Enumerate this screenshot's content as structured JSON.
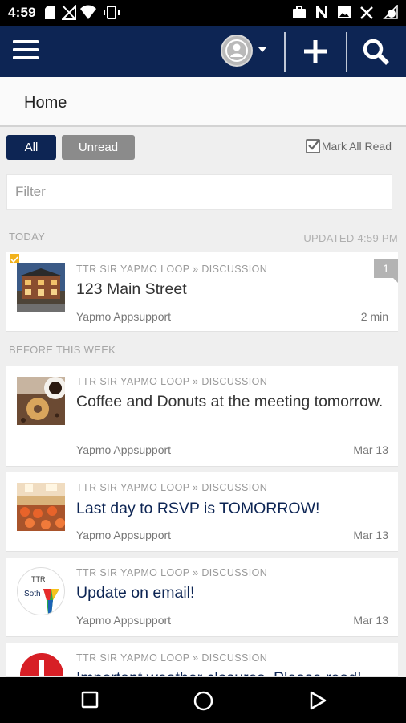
{
  "status_bar": {
    "time": "4:59",
    "icons": [
      "sd-card-icon",
      "no-signal-icon",
      "wifi-icon",
      "vibrate-icon",
      "briefcase-icon",
      "n-app-icon",
      "image-icon",
      "shuffle-icon",
      "battery-icon"
    ]
  },
  "app_bar": {
    "icons": [
      "menu-icon",
      "avatar-icon",
      "caret-down-icon",
      "plus-icon",
      "search-icon"
    ]
  },
  "header": {
    "title": "Home"
  },
  "tabs": [
    {
      "label": "All",
      "active": true
    },
    {
      "label": "Unread",
      "active": false
    }
  ],
  "mark_all": {
    "label": "Mark All Read"
  },
  "filter": {
    "placeholder": "Filter",
    "value": ""
  },
  "sections": {
    "today": "TODAY",
    "updated": "UPDATED 4:59 PM",
    "before": "BEFORE THIS WEEK"
  },
  "posts": [
    {
      "path": "TTR SIR YAPMO LOOP » DISCUSSION",
      "title": "123 Main Street",
      "author": "Yapmo Appsupport",
      "date": "2 min",
      "badge": "1",
      "thumb": "building-thumbnail"
    },
    {
      "path": "TTR SIR YAPMO LOOP » DISCUSSION",
      "title": "Coffee and Donuts at the meeting tomorrow.",
      "author": "Yapmo Appsupport",
      "date": "Mar 13",
      "thumb": "coffee-donut-thumbnail"
    },
    {
      "path": "TTR SIR YAPMO LOOP » DISCUSSION",
      "title": "Last day to RSVP is TOMORROW!",
      "author": "Yapmo Appsupport",
      "date": "Mar 13",
      "thumb": "event-room-thumbnail"
    },
    {
      "path": "TTR SIR YAPMO LOOP » DISCUSSION",
      "title": "Update on email!",
      "author": "Yapmo Appsupport",
      "date": "Mar 13",
      "thumb": "ttr-logo-thumbnail",
      "logo_text": "TTR",
      "logo_text2": "Soth"
    },
    {
      "path": "TTR SIR YAPMO LOOP » DISCUSSION",
      "title": "Important weather closures. Please read!",
      "thumb": "alert-icon"
    }
  ],
  "colors": {
    "navy": "#0d2554",
    "unread_flag": "#f2b21c",
    "alert_red": "#d71f26"
  }
}
